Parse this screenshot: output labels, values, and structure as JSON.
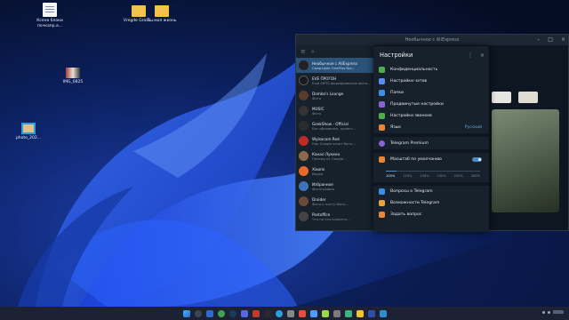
{
  "desktop": {
    "icons": [
      {
        "label": "Ксено блоки почкапр.а..."
      },
      {
        "label": "Vregde Gross..."
      },
      {
        "label": "Ты моя жизнь"
      },
      {
        "label": "IMG_0825"
      },
      {
        "label": "photo_202..."
      }
    ]
  },
  "telegram": {
    "window_title": "Необычное с AliExpress",
    "chats": [
      {
        "name": "Необычное с AliExpress",
        "preview": "Смартфон OnePlus Nor..."
      },
      {
        "name": "EVE ПРОГОН",
        "preview": "Ещё MPTS формирование фото..."
      },
      {
        "name": "Dombo's Lounge",
        "preview": "Фото"
      },
      {
        "name": "MUSIC",
        "preview": "Фото"
      },
      {
        "name": "GeekShow - Official",
        "preview": "Бот обновился, проект..."
      },
      {
        "name": "Wylsacom Red",
        "preview": "Как Google хочет быть..."
      },
      {
        "name": "Канал Лукина",
        "preview": "Почему от Google..."
      },
      {
        "name": "Xiaomi",
        "preview": "Видео"
      },
      {
        "name": "Избранное",
        "preview": "Фотография"
      },
      {
        "name": "Droider",
        "preview": "Фото к посту Фото..."
      },
      {
        "name": "Postoffice",
        "preview": "Что на это скажете..."
      }
    ]
  },
  "settings": {
    "title": "Настройки",
    "items": [
      {
        "label": "Конфиденциальность",
        "value": ""
      },
      {
        "label": "Настройки чатов",
        "value": ""
      },
      {
        "label": "Папки",
        "value": ""
      },
      {
        "label": "Продвинутые настройки",
        "value": ""
      },
      {
        "label": "Настройки звонков",
        "value": ""
      },
      {
        "label": "Язык",
        "value": "Русский"
      }
    ],
    "premium_label": "Telegram Premium",
    "zoom_label": "Масштаб по умолчанию",
    "zoom_enabled": true,
    "zoom_levels": [
      "100%",
      "125%",
      "150%",
      "200%",
      "250%",
      "300%"
    ],
    "zoom_selected": "100%",
    "help_items": [
      {
        "label": "Вопросы о Telegram"
      },
      {
        "label": "Возможности Telegram"
      },
      {
        "label": "Задать вопрос"
      }
    ]
  },
  "colors": {
    "accent": "#5288c1",
    "panel": "#17212b",
    "background": "#0e1621"
  }
}
